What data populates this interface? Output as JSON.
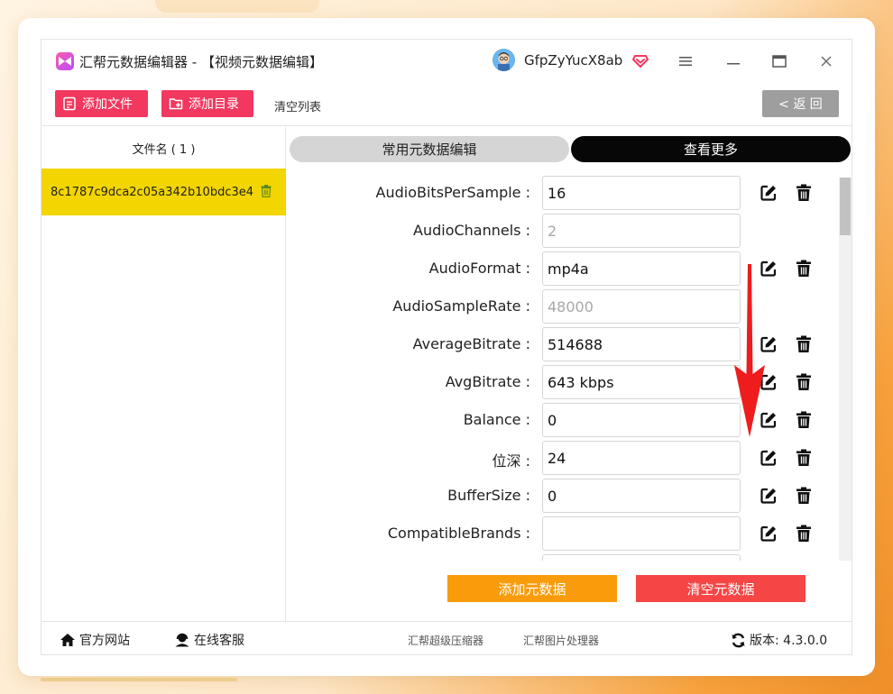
{
  "window": {
    "title": "汇帮元数据编辑器 - 【视频元数据编辑】",
    "username": "GfpZyYucX8ab"
  },
  "toolbar": {
    "add_file": "添加文件",
    "add_folder": "添加目录",
    "clear_list": "清空列表",
    "back": "< 返 回"
  },
  "file_list": {
    "header": "文件名 ( 1 )",
    "files": [
      "8c1787c9dca2c05a342b10bdc3e4"
    ]
  },
  "tabs": {
    "common": "常用元数据编辑",
    "more": "查看更多"
  },
  "metadata": [
    {
      "label": "AudioBitsPerSample :",
      "value": "16",
      "editable": true
    },
    {
      "label": "AudioChannels :",
      "value": "2",
      "editable": false
    },
    {
      "label": "AudioFormat :",
      "value": "mp4a",
      "editable": true
    },
    {
      "label": "AudioSampleRate :",
      "value": "48000",
      "editable": false
    },
    {
      "label": "AverageBitrate :",
      "value": "514688",
      "editable": true
    },
    {
      "label": "AvgBitrate :",
      "value": "643 kbps",
      "editable": true
    },
    {
      "label": "Balance :",
      "value": "0",
      "editable": true
    },
    {
      "label": "位深 :",
      "value": "24",
      "editable": true
    },
    {
      "label": "BufferSize :",
      "value": "0",
      "editable": true
    },
    {
      "label": "CompatibleBrands :",
      "value": "",
      "editable": true
    }
  ],
  "actions": {
    "add_metadata": "添加元数据",
    "clear_metadata": "清空元数据"
  },
  "footer": {
    "website": "官方网站",
    "support": "在线客服",
    "compressor": "汇帮超级压缩器",
    "image_tool": "汇帮图片处理器",
    "version": "版本: 4.3.0.0"
  },
  "colors": {
    "accent_pink": "#f2385f",
    "selected_file": "#f2d501",
    "add_button": "#f99c0b",
    "clear_button": "#f64545",
    "annotation_arrow": "#ee1c1c"
  }
}
